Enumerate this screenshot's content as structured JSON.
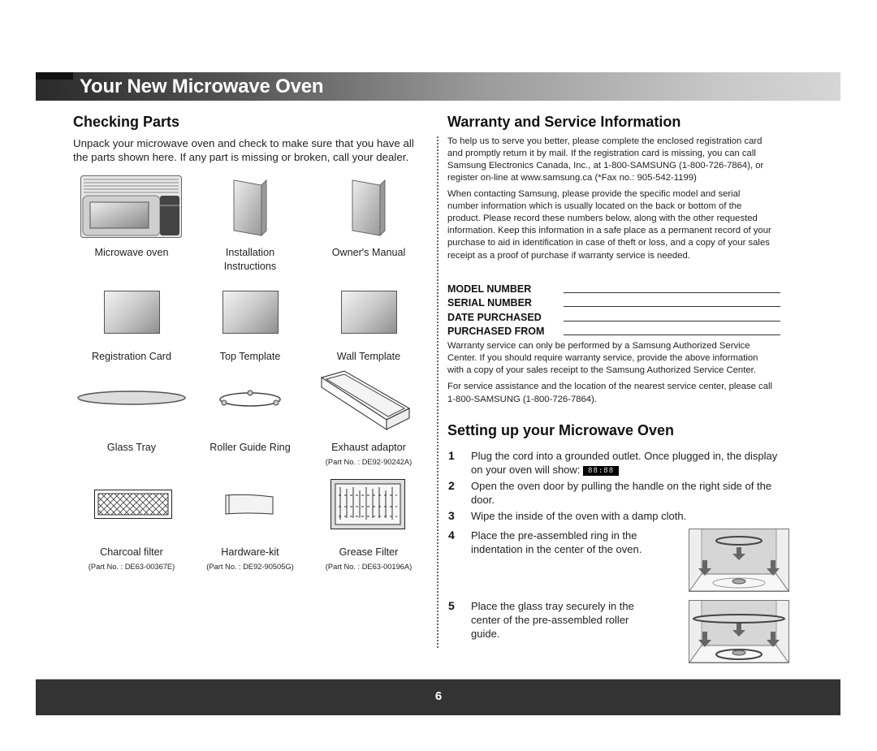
{
  "page": {
    "title": "Your New Microwave Oven",
    "page_number": "6"
  },
  "checking_parts": {
    "heading": "Checking Parts",
    "intro_line1": "Unpack your microwave oven and check to make sure that you have all",
    "intro_line2": "the parts shown here. If any part is missing or broken, call your dealer.",
    "parts": [
      {
        "label": "Microwave oven",
        "icon": "microwave-oven-icon"
      },
      {
        "label_line1": "Installation",
        "label_line2": "Instructions",
        "icon": "booklet-icon"
      },
      {
        "label": "Owner's Manual",
        "icon": "booklet-icon"
      },
      {
        "label": "Registration Card",
        "icon": "card-icon"
      },
      {
        "label": "Top Template",
        "icon": "card-icon"
      },
      {
        "label": "Wall Template",
        "icon": "card-icon"
      },
      {
        "label": "Glass Tray",
        "icon": "glass-tray-icon"
      },
      {
        "label": "Roller Guide Ring",
        "icon": "roller-ring-icon"
      },
      {
        "label": "Exhaust adaptor",
        "part_no": "(Part No. : DE92-90242A)",
        "icon": "exhaust-adaptor-icon"
      },
      {
        "label": "Charcoal filter",
        "part_no": "(Part No. : DE63-00367E)",
        "icon": "charcoal-filter-icon"
      },
      {
        "label": "Hardware-kit",
        "part_no": "(Part No. : DE92-90505G)",
        "icon": "hardware-kit-icon"
      },
      {
        "label": "Grease Filter",
        "part_no": "(Part No. : DE63-00196A)",
        "icon": "grease-filter-icon"
      }
    ]
  },
  "warranty": {
    "heading": "Warranty and Service Information",
    "para1": [
      "To help us to serve you better, please complete the enclosed registration card",
      "and promptly return it by mail.  If the registration card is missing, you can call",
      "Samsung Electronics Canada, Inc., at 1-800-SAMSUNG (1-800-726-7864), or",
      "register on-line at www.samsung.ca (*Fax no.: 905-542-1199)"
    ],
    "para2": [
      "When contacting Samsung, please provide the specific model and serial",
      "number information which is usually located on the back or bottom of the",
      "product.  Please record these numbers below, along with the other requested",
      "information.  Keep this information in a safe place as a permanent record of your",
      "purchase to aid in identification in case of theft or loss, and a copy of your sales",
      "receipt as a proof of purchase if warranty service is needed."
    ],
    "form_fields": [
      {
        "label": "MODEL NUMBER",
        "value": ""
      },
      {
        "label": "SERIAL NUMBER",
        "value": ""
      },
      {
        "label": "DATE PURCHASED",
        "value": ""
      },
      {
        "label": "PURCHASED FROM",
        "value": ""
      }
    ],
    "para3": [
      "Warranty service can only be performed by a Samsung Authorized Service",
      "Center. If you should require warranty service, provide the above information",
      "with a copy of your sales receipt to the Samsung Authorized Service Center."
    ],
    "para4": [
      "For service assistance and the location of the nearest service center, please call",
      "1-800-SAMSUNG (1-800-726-7864)."
    ]
  },
  "setup": {
    "heading": "Setting up your Microwave Oven",
    "steps": [
      {
        "num": "1",
        "lines": [
          "Plug the cord into a grounded outlet. Once plugged in, the display",
          "on your oven will show:"
        ],
        "display": "88:88"
      },
      {
        "num": "2",
        "lines": [
          "Open the oven door by pulling the handle on the right side of the",
          "door."
        ]
      },
      {
        "num": "3",
        "lines": [
          "Wipe the inside of the oven with a damp cloth."
        ]
      },
      {
        "num": "4",
        "lines": [
          "Place the pre-assembled ring in the",
          "indentation in the center of the oven."
        ]
      },
      {
        "num": "5",
        "lines": [
          "Place the glass tray securely in the",
          "center of the pre-assembled roller",
          "guide."
        ]
      }
    ]
  }
}
